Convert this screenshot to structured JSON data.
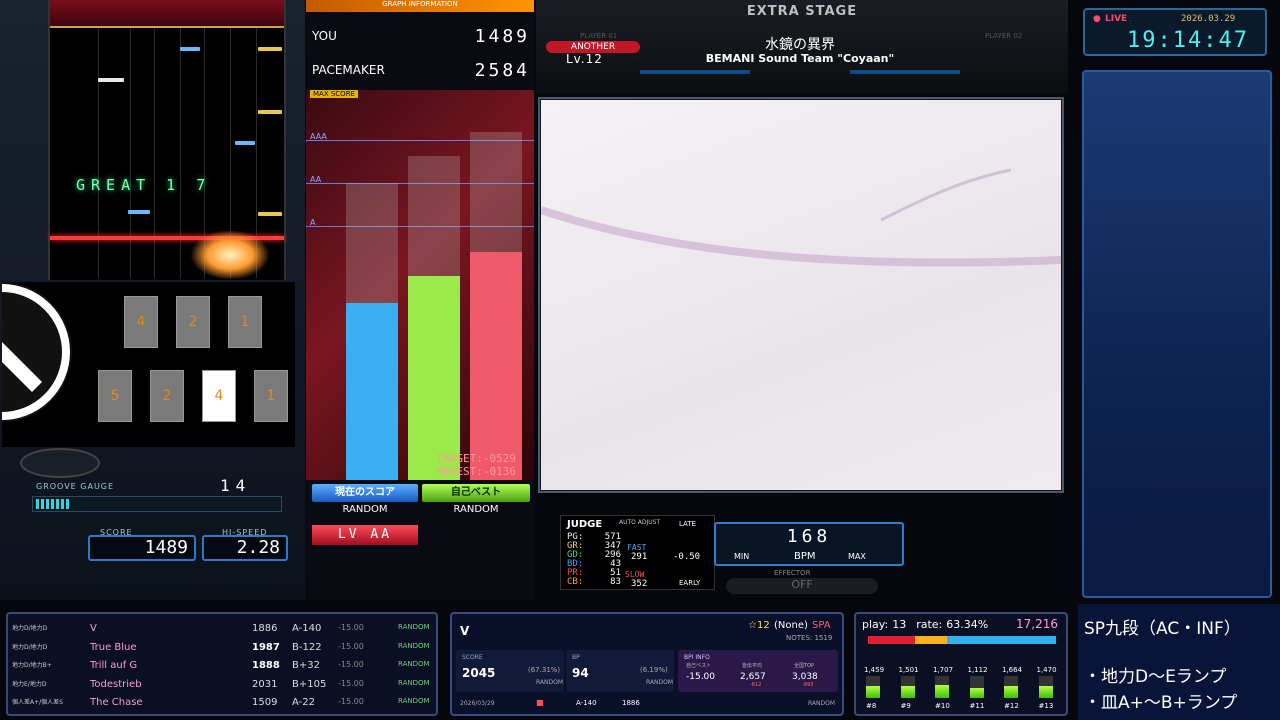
{
  "left": {
    "judge_text": "GREAT 1 7",
    "keys_top": [
      "4",
      "2",
      "1"
    ],
    "keys_bottom": [
      "5",
      "2",
      "4",
      "1"
    ],
    "gauge_value": "14",
    "gauge_label": "GROOVE GAUGE",
    "score_label": "SCORE",
    "score_value": "1489",
    "hispeed_label": "HI-SPEED",
    "hispeed_value": "2.28"
  },
  "graph": {
    "header": "GRAPH INFORMATION",
    "you_label": "YOU",
    "you_value": "1489",
    "pacemaker_label": "PACEMAKER",
    "pacemaker_value": "2584",
    "max_label": "MAX SCORE",
    "grades": [
      "AAA",
      "AA",
      "A"
    ],
    "target": "TARGET:-0529",
    "mybest": "MYBEST:-0136",
    "btn_current": "現在のスコア",
    "btn_best": "自己ベスト",
    "opt_current": "RANDOM",
    "opt_best": "RANDOM",
    "level_badge": "LV AA",
    "bars": [
      {
        "name": "current",
        "fill": 0.59,
        "color": "#3ab0f0"
      },
      {
        "name": "best",
        "fill": 0.68,
        "color": "#9aea4a"
      },
      {
        "name": "pacemaker",
        "fill": 0.76,
        "color": "#ee5a6a"
      }
    ]
  },
  "stage": {
    "title": "EXTRA STAGE",
    "player1": "PLAYER 01",
    "player2": "PLAYER 02",
    "difficulty": "ANOTHER",
    "level": "Lv.12",
    "song_title": "水鏡の異界",
    "artist": "BEMANI Sound Team \"Coyaan\""
  },
  "judge": {
    "title": "JUDGE",
    "auto_adjust": "AUTO ADJUST",
    "late_label": "LATE",
    "rows": [
      {
        "k": "PG:",
        "v": "571"
      },
      {
        "k": "GR:",
        "v": "347"
      },
      {
        "k": "GD:",
        "v": "296"
      },
      {
        "k": "BD:",
        "v": "43"
      },
      {
        "k": "PR:",
        "v": "51"
      },
      {
        "k": "CB:",
        "v": "83"
      }
    ],
    "fast_label": "FAST",
    "fast_value": "291",
    "offset": "-0.50",
    "slow_label": "SLOW",
    "slow_value": "352",
    "early_label": "EARLY"
  },
  "bpm": {
    "value": "168",
    "min_label": "MIN",
    "bpm_label": "BPM",
    "max_label": "MAX",
    "effector_label": "EFFECTOR",
    "effector_value": "OFF"
  },
  "clock": {
    "live": "LIVE",
    "date": "2026.03.29",
    "time": "19:14:47"
  },
  "history": [
    {
      "lamp": "地力D/地力D",
      "title": "V",
      "score": "1886",
      "diff": "A-140",
      "bpi": "-15.00",
      "opt": "RANDOM",
      "bold": false
    },
    {
      "lamp": "地力D/地力D",
      "title": "True Blue",
      "score": "1987",
      "diff": "B-122",
      "bpi": "-15.00",
      "opt": "RANDOM",
      "bold": true
    },
    {
      "lamp": "地力D/地力B+",
      "title": "Trill auf G",
      "score": "1888",
      "diff": "B+32",
      "bpi": "-15.00",
      "opt": "RANDOM",
      "bold": true
    },
    {
      "lamp": "地力E/地力D",
      "title": "Todestrieb",
      "score": "2031",
      "diff": "B+105",
      "bpi": "-15.00",
      "opt": "RANDOM",
      "bold": false
    },
    {
      "lamp": "個人差A+/個人差S",
      "title": "The Chase",
      "score": "1509",
      "diff": "A-22",
      "bpi": "-15.00",
      "opt": "RANDOM",
      "bold": false
    }
  ],
  "song_card": {
    "title": "V",
    "level": "☆12",
    "none": "(None)",
    "spa": "SPA",
    "notes": "NOTES: 1519",
    "score_label": "SCORE",
    "score_value": "2045",
    "score_pct": "(67.31%)",
    "score_opt": "RANDOM",
    "bp_label": "BP",
    "bp_value": "94",
    "bp_pct": "(6.19%)",
    "bp_opt": "RANDOM",
    "bpi_label": "BPI INFO",
    "bpi_col1": "自己ベスト",
    "bpi_col2": "皆伝平均",
    "bpi_col3": "全国TOP",
    "bpi_v1": "-15.00",
    "bpi_v2": "2,657",
    "bpi_v2sub": "-612",
    "bpi_v3": "3,038",
    "bpi_v3sub": "-993",
    "footer_date": "2026/03/29",
    "footer_score": "1886",
    "footer_diff": "A-140",
    "footer_opt": "RANDOM"
  },
  "play_card": {
    "play_label": "play:",
    "play_value": "13",
    "rate_label": "rate:",
    "rate_value": "63.34%",
    "total": "17,216",
    "levels": [
      {
        "count": "1,459",
        "label": "#8",
        "fill": 0.55
      },
      {
        "count": "1,501",
        "label": "#9",
        "fill": 0.55
      },
      {
        "count": "1,707",
        "label": "#10",
        "fill": 0.6
      },
      {
        "count": "1,112",
        "label": "#11",
        "fill": 0.45
      },
      {
        "count": "1,664",
        "label": "#12",
        "fill": 0.55
      },
      {
        "count": "1,470",
        "label": "#13",
        "fill": 0.55
      }
    ]
  },
  "dan": {
    "title": "SP九段（AC・INF）",
    "line1": "・地力D〜Eランプ",
    "line2": "・皿A+〜B+ランプ"
  }
}
